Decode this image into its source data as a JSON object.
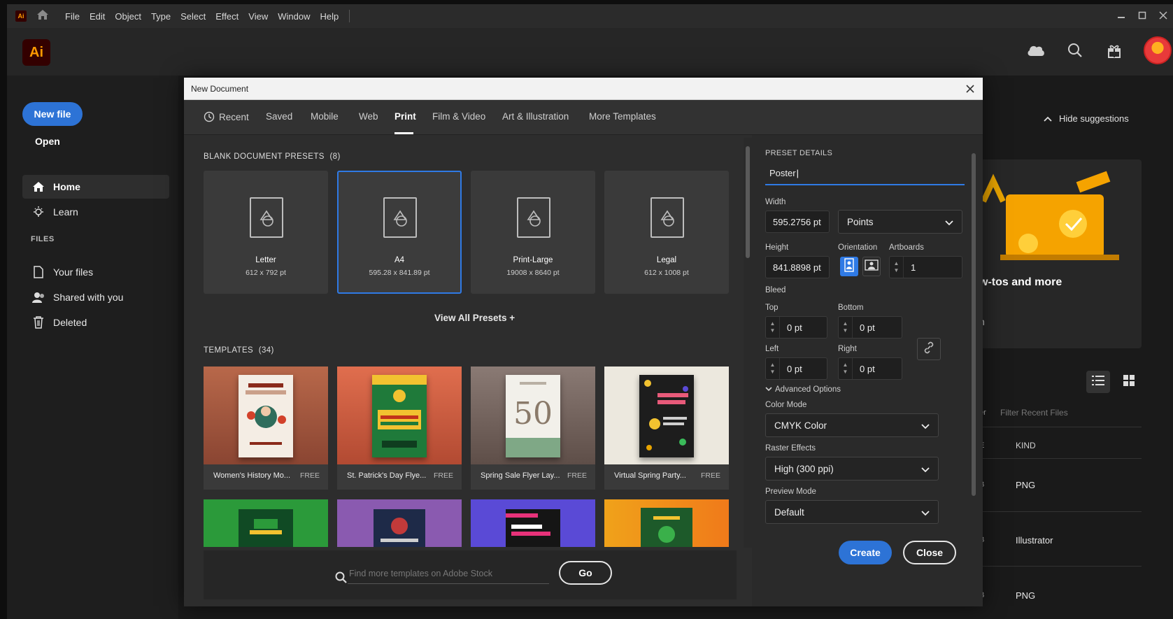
{
  "menubar": {
    "items": [
      "File",
      "Edit",
      "Object",
      "Type",
      "Select",
      "Effect",
      "View",
      "Window",
      "Help"
    ],
    "app_badge": "Ai"
  },
  "header": {
    "logo": "Ai"
  },
  "sidebar": {
    "new_file": "New file",
    "open": "Open",
    "nav": [
      "Home",
      "Learn"
    ],
    "files_header": "FILES",
    "files": [
      "Your files",
      "Shared with you",
      "Deleted"
    ]
  },
  "background": {
    "hide_suggestions": "Hide suggestions",
    "card_title": "w-tos and more",
    "card_sub": "n",
    "filter_placeholder": "Filter Recent Files",
    "col_frag_1": "er",
    "col_frag_2": "E",
    "kind_header": "KIND",
    "rows": [
      {
        "frag": "B",
        "kind": "PNG"
      },
      {
        "frag": "B",
        "kind": "Illustrator"
      },
      {
        "frag": "B",
        "kind": "PNG"
      }
    ]
  },
  "dialog": {
    "title": "New Document",
    "tabs": [
      "Recent",
      "Saved",
      "Mobile",
      "Web",
      "Print",
      "Film & Video",
      "Art & Illustration",
      "More Templates"
    ],
    "active_tab": "Print",
    "blank_header": "BLANK DOCUMENT PRESETS",
    "blank_count": "(8)",
    "presets": [
      {
        "name": "Letter",
        "size": "612 x 792 pt"
      },
      {
        "name": "A4",
        "size": "595.28 x 841.89 pt"
      },
      {
        "name": "Print-Large",
        "size": "19008 x 8640 pt"
      },
      {
        "name": "Legal",
        "size": "612 x 1008 pt"
      }
    ],
    "view_all": "View All Presets +",
    "templates_header": "TEMPLATES",
    "templates_count": "(34)",
    "templates": [
      {
        "name": "Women's History Mo...",
        "badge": "FREE"
      },
      {
        "name": "St. Patrick's Day Flye...",
        "badge": "FREE"
      },
      {
        "name": "Spring Sale Flyer Lay...",
        "badge": "FREE"
      },
      {
        "name": "Virtual Spring Party...",
        "badge": "FREE"
      }
    ],
    "stock_placeholder": "Find more templates on Adobe Stock",
    "go": "Go",
    "details": {
      "header": "PRESET DETAILS",
      "name_value": "Poster",
      "width_label": "Width",
      "width_value": "595.2756 pt",
      "units": "Points",
      "height_label": "Height",
      "height_value": "841.8898 pt",
      "orientation_label": "Orientation",
      "artboards_label": "Artboards",
      "artboards_value": "1",
      "bleed_label": "Bleed",
      "top_label": "Top",
      "top_value": "0 pt",
      "bottom_label": "Bottom",
      "bottom_value": "0 pt",
      "left_label": "Left",
      "left_value": "0 pt",
      "right_label": "Right",
      "right_value": "0 pt",
      "advanced": "Advanced Options",
      "color_mode_label": "Color Mode",
      "color_mode": "CMYK Color",
      "raster_label": "Raster Effects",
      "raster": "High (300 ppi)",
      "preview_label": "Preview Mode",
      "preview": "Default"
    },
    "create": "Create",
    "close": "Close"
  },
  "colors": {
    "accent": "#2d73d6",
    "ai_orange": "#ff9a00",
    "ai_bg": "#330000"
  }
}
